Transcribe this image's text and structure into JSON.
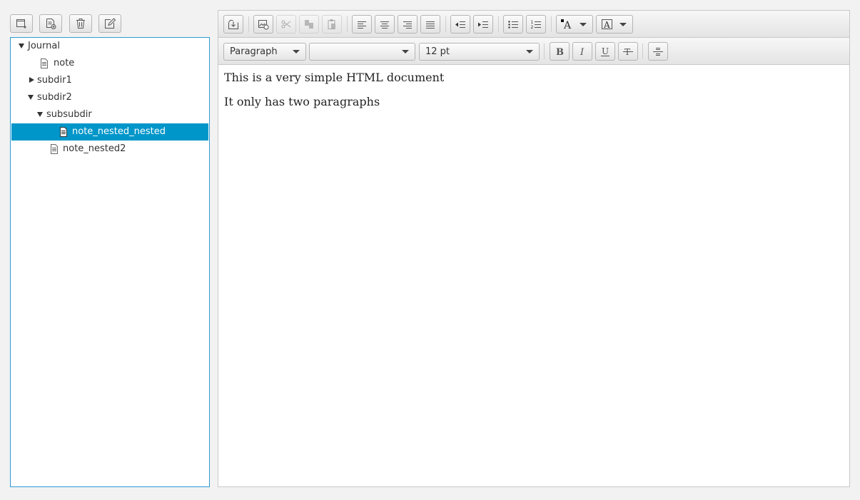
{
  "toolbar": {
    "buttons": [
      {
        "name": "new-folder",
        "icon": "new-folder-icon"
      },
      {
        "name": "new-note",
        "icon": "new-note-icon"
      },
      {
        "name": "delete",
        "icon": "trash-icon"
      },
      {
        "name": "rename",
        "icon": "edit-icon"
      }
    ]
  },
  "tree": {
    "items": [
      {
        "label": "Journal",
        "kind": "folder",
        "expanded": true
      },
      {
        "label": "note",
        "kind": "file"
      },
      {
        "label": "subdir1",
        "kind": "folder",
        "expanded": false
      },
      {
        "label": "subdir2",
        "kind": "folder",
        "expanded": true
      },
      {
        "label": "subsubdir",
        "kind": "folder",
        "expanded": true
      },
      {
        "label": "note_nested_nested",
        "kind": "file",
        "selected": true
      },
      {
        "label": "note_nested2",
        "kind": "file"
      }
    ]
  },
  "editor": {
    "paragraph_style": "Paragraph",
    "font_family": "",
    "font_size": "12 pt",
    "content": [
      "This is a very simple HTML document",
      "It only has two paragraphs"
    ]
  },
  "colors": {
    "selection": "#0096c9",
    "tree_border": "#2e9bd6",
    "background": "#f2f2f2"
  }
}
